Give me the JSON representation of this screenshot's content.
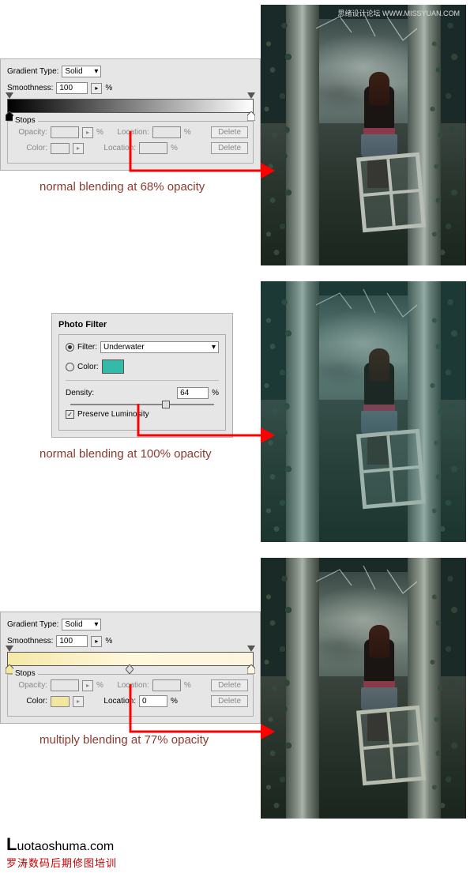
{
  "watermarks": {
    "top_left": "思绪设计论坛",
    "top_right": "WWW.MISSYUAN.COM",
    "bottom_url": "uotaoshuma.com",
    "bottom_url_first": "L",
    "bottom_text": "罗涛数码后期修图培训"
  },
  "gradient1": {
    "type_label": "Gradient Type:",
    "type_value": "Solid",
    "smoothness_label": "Smoothness:",
    "smoothness_value": "100",
    "pct": "%",
    "stops_label": "Stops",
    "opacity_label": "Opacity:",
    "location_label": "Location:",
    "color_label": "Color:",
    "delete_label": "Delete",
    "caption": "normal blending at 68% opacity"
  },
  "photofilter": {
    "title": "Photo Filter",
    "filter_label": "Filter:",
    "filter_value": "Underwater",
    "color_label": "Color:",
    "color_hex": "#35b9a8",
    "density_label": "Density:",
    "density_value": 64,
    "pct": "%",
    "preserve_label": "Preserve Luminosity",
    "caption": "normal blending at 100% opacity"
  },
  "gradient2": {
    "type_label": "Gradient Type:",
    "type_value": "Solid",
    "smoothness_label": "Smoothness:",
    "smoothness_value": "100",
    "pct": "%",
    "stops_label": "Stops",
    "opacity_label": "Opacity:",
    "location_label": "Location:",
    "location_value": "0",
    "color_label": "Color:",
    "delete_label": "Delete",
    "caption": "multiply blending at 77% opacity"
  }
}
